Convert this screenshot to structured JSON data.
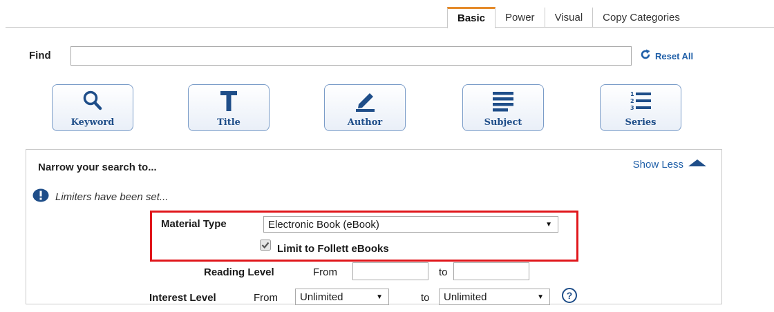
{
  "tabs": [
    {
      "label": "Basic",
      "active": true
    },
    {
      "label": "Power",
      "active": false
    },
    {
      "label": "Visual",
      "active": false
    },
    {
      "label": "Copy Categories",
      "active": false
    }
  ],
  "find": {
    "label": "Find",
    "value": "",
    "reset_label": "Reset All"
  },
  "search_types": [
    {
      "label": "Keyword",
      "icon": "magnifier-icon"
    },
    {
      "label": "Title",
      "icon": "title-t-icon"
    },
    {
      "label": "Author",
      "icon": "pencil-icon"
    },
    {
      "label": "Subject",
      "icon": "lines-icon"
    },
    {
      "label": "Series",
      "icon": "numbered-list-icon"
    }
  ],
  "narrow": {
    "title": "Narrow your search to...",
    "show_less": "Show Less",
    "limiters_notice": "Limiters have been set...",
    "material_type": {
      "label": "Material Type",
      "selected": "Electronic Book (eBook)"
    },
    "follett": {
      "label": "Limit to Follett eBooks",
      "checked": true
    },
    "reading_level": {
      "label": "Reading Level",
      "from_label": "From",
      "to_label": "to",
      "from_value": "",
      "to_value": ""
    },
    "interest_level": {
      "label": "Interest Level",
      "from_label": "From",
      "to_label": "to",
      "from_selected": "Unlimited",
      "to_selected": "Unlimited"
    }
  },
  "colors": {
    "accent_tab": "#e58b2b",
    "link_blue": "#1f5fa8",
    "button_text": "#1f4e89",
    "highlight_red": "#e0161b"
  }
}
